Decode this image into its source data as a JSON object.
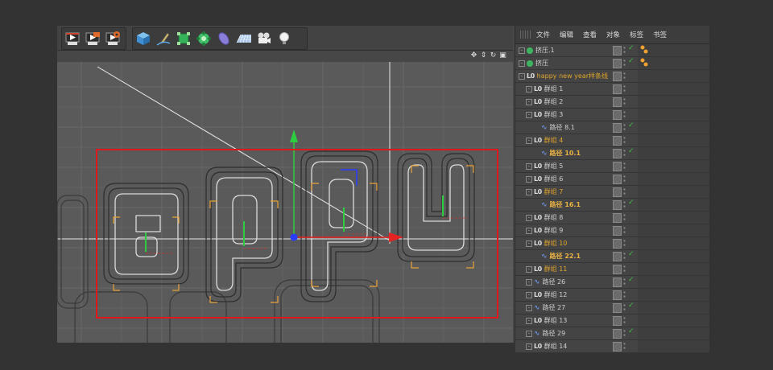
{
  "object_manager": {
    "menu": [
      "文件",
      "编辑",
      "查看",
      "对象",
      "标签",
      "书签"
    ],
    "rows": [
      {
        "name": "挤压.1",
        "level": 0,
        "kind": "extrude",
        "style": "normal",
        "has_tag": true,
        "check": true
      },
      {
        "name": "挤压",
        "level": 0,
        "kind": "extrude",
        "style": "normal",
        "has_tag": true,
        "check": true
      },
      {
        "name": "happy new year样条线",
        "level": 0,
        "kind": "null",
        "style": "hi",
        "has_tag": false,
        "check": false
      },
      {
        "name": "群组 1",
        "level": 1,
        "kind": "null",
        "style": "normal",
        "check": false
      },
      {
        "name": "群组 2",
        "level": 1,
        "kind": "null",
        "style": "normal",
        "check": false
      },
      {
        "name": "群组 3",
        "level": 1,
        "kind": "null",
        "style": "normal",
        "check": false
      },
      {
        "name": "路径 8.1",
        "level": 2,
        "kind": "spline",
        "style": "normal",
        "check": true
      },
      {
        "name": "群组 4",
        "level": 1,
        "kind": "null",
        "style": "hi",
        "check": false
      },
      {
        "name": "路径 10.1",
        "level": 2,
        "kind": "spline",
        "style": "sel",
        "check": true
      },
      {
        "name": "群组 5",
        "level": 1,
        "kind": "null",
        "style": "normal",
        "check": false
      },
      {
        "name": "群组 6",
        "level": 1,
        "kind": "null",
        "style": "normal",
        "check": false
      },
      {
        "name": "群组 7",
        "level": 1,
        "kind": "null",
        "style": "hi",
        "check": false
      },
      {
        "name": "路径 16.1",
        "level": 2,
        "kind": "spline",
        "style": "sel",
        "check": true
      },
      {
        "name": "群组 8",
        "level": 1,
        "kind": "null",
        "style": "normal",
        "check": false
      },
      {
        "name": "群组 9",
        "level": 1,
        "kind": "null",
        "style": "normal",
        "check": false
      },
      {
        "name": "群组 10",
        "level": 1,
        "kind": "null",
        "style": "hi",
        "check": false
      },
      {
        "name": "路径 22.1",
        "level": 2,
        "kind": "spline",
        "style": "sel",
        "check": true
      },
      {
        "name": "群组 11",
        "level": 1,
        "kind": "null",
        "style": "hi",
        "check": false
      },
      {
        "name": "路径 26",
        "level": 1,
        "kind": "spline",
        "style": "normal",
        "check": true
      },
      {
        "name": "群组 12",
        "level": 1,
        "kind": "null",
        "style": "normal",
        "check": false
      },
      {
        "name": "路径 27",
        "level": 1,
        "kind": "spline",
        "style": "normal",
        "check": true
      },
      {
        "name": "群组 13",
        "level": 1,
        "kind": "null",
        "style": "normal",
        "check": false
      },
      {
        "name": "路径 29",
        "level": 1,
        "kind": "spline",
        "style": "normal",
        "check": true
      },
      {
        "name": "群组 14",
        "level": 1,
        "kind": "null",
        "style": "normal",
        "check": false
      }
    ]
  },
  "toolbar": {
    "group1": [
      "render-view-icon",
      "render-picture-viewer-icon",
      "render-settings-icon"
    ],
    "group2": [
      "cube-icon",
      "pen-icon",
      "subdivision-icon",
      "mograph-icon",
      "deformer-icon",
      "floor-icon",
      "camera-icon",
      "light-icon"
    ]
  },
  "viewport": {
    "nav_icons": [
      "move-view-icon",
      "pan-view-icon",
      "rotate-view-icon",
      "maximize-view-icon"
    ]
  },
  "colors": {
    "accent_orange": "#e0a52b",
    "selection_red": "#e0181b",
    "axis_y": "#2ecc40",
    "axis_x": "#e62222",
    "axis_z": "#2a3cff"
  }
}
